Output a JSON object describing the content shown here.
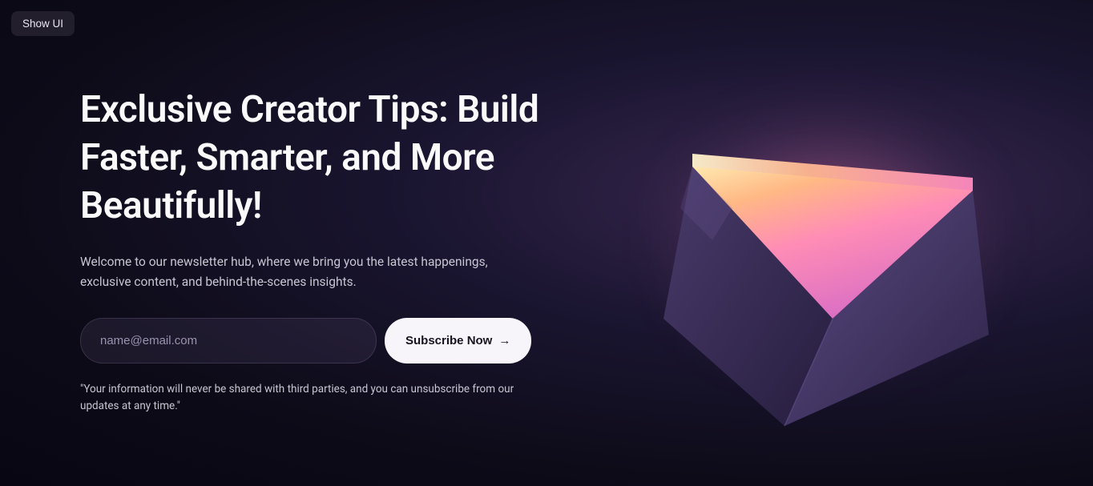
{
  "ui": {
    "show_ui_label": "Show UI"
  },
  "hero": {
    "heading": "Exclusive Creator Tips: Build Faster, Smarter, and More Beautifully!",
    "subtext": "Welcome to our newsletter hub, where we bring you the latest happenings, exclusive content, and behind-the-scenes insights.",
    "email_placeholder": "name@email.com",
    "subscribe_label": "Subscribe Now",
    "disclaimer": "\"Your information will never be shared with third parties, and you can unsubscribe from our updates at any time.\""
  }
}
